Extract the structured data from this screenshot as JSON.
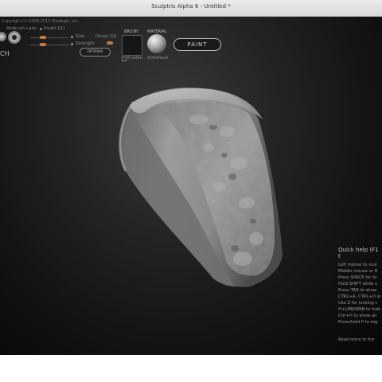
{
  "window": {
    "title": "Sculptris Alpha 6 - Untitled *"
  },
  "toolbar": {
    "copyright": "Copyright (c) 2009-2011 Pixologic, Inc.",
    "airbrush_label": "Airbrush",
    "lazy_label": "Lazy",
    "invert_label": "Invert [X]",
    "size_label": "Size",
    "detail_label": "Detail [Q]",
    "strength_label": "Strength",
    "options_label": "OPTIONS",
    "tool_label_fragment": "CH",
    "brush_label": "BRUSH",
    "enable_label": "Enable",
    "material_label": "MATERIAL",
    "material_name": "00default",
    "paint_label": "PAINT"
  },
  "quick_help": {
    "title": "Quick help (F1 t",
    "lines": [
      "Left mouse to scul",
      "Middle mouse or R",
      "Press SPACE for to",
      "Hold SHIFT while s",
      "Press TAB to show",
      "CTRL+A, CTRL+D w",
      "Use Z for locking c",
      "H+LMB/RMB to hide",
      "Ctrl+H to show all",
      "Press/hold P to tog"
    ],
    "more": "Read more in the"
  },
  "colors": {
    "viewport_bg": "#1a1a1a",
    "slider_accent": "#c87a3a",
    "model_base": "#9a9a9a"
  }
}
